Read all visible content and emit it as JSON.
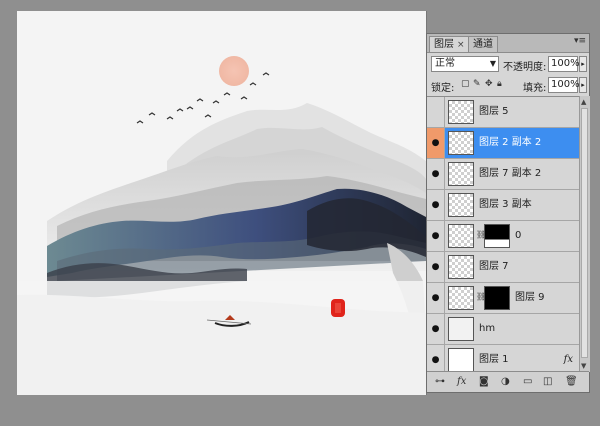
{
  "panel": {
    "tabs": [
      {
        "label": "图层",
        "close": "×"
      },
      {
        "label": "通道"
      }
    ],
    "menu_icon": "panel-menu-icon",
    "blend_mode": "正常",
    "opacity_label": "不透明度:",
    "opacity_value": "100%",
    "lock_label": "锁定:",
    "fill_label": "填充:",
    "fill_value": "100%",
    "layers": [
      {
        "name": "图层 5",
        "visible": false,
        "selected": false,
        "thumb": "transparent"
      },
      {
        "name": "图层 2 副本 2",
        "visible": true,
        "selected": true,
        "thumb": "transparent"
      },
      {
        "name": "图层 7 副本 2",
        "visible": true,
        "selected": false,
        "thumb": "transparent"
      },
      {
        "name": "图层 3 副本",
        "visible": true,
        "selected": false,
        "thumb": "transparent"
      },
      {
        "name": "0",
        "visible": true,
        "selected": false,
        "thumb": "transparent",
        "mask": "grad"
      },
      {
        "name": "图层 7",
        "visible": true,
        "selected": false,
        "thumb": "transparent"
      },
      {
        "name": "图层 9",
        "visible": true,
        "selected": false,
        "thumb": "transparent",
        "mask": "black"
      },
      {
        "name": "hm",
        "visible": true,
        "selected": false,
        "thumb": "sketch"
      },
      {
        "name": "图层 1",
        "visible": true,
        "selected": false,
        "thumb": "white",
        "fx": "fx"
      }
    ],
    "bottom_icons": [
      "link-icon",
      "fx-icon",
      "mask-icon",
      "adjustment-icon",
      "folder-icon",
      "new-layer-icon",
      "trash-icon"
    ],
    "bottom_labels": {
      "fx": "fx"
    }
  },
  "canvas": {
    "colors": {
      "sun": "#f2c1ad",
      "seal": "#e0241b",
      "ink_dark": "#2a2d3a",
      "ink_blue": "#3a4c8a",
      "ink_teal": "#5e7e85"
    }
  }
}
